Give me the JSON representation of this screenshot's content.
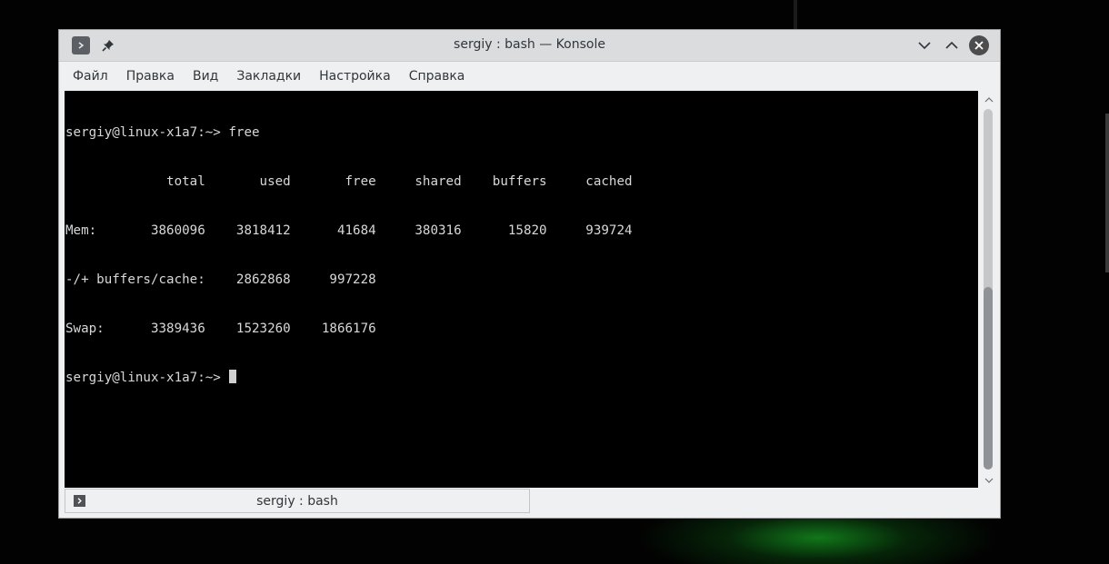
{
  "window": {
    "title": "sergiy : bash — Konsole"
  },
  "menu": {
    "items": [
      {
        "label": "Файл"
      },
      {
        "label": "Правка"
      },
      {
        "label": "Вид"
      },
      {
        "label": "Закладки"
      },
      {
        "label": "Настройка"
      },
      {
        "label": "Справка"
      }
    ]
  },
  "terminal": {
    "lines": [
      "sergiy@linux-x1a7:~> free",
      "             total       used       free     shared    buffers     cached",
      "Mem:       3860096    3818412      41684     380316      15820     939724",
      "-/+ buffers/cache:    2862868     997228",
      "Swap:      3389436    1523260    1866176"
    ],
    "prompt": "sergiy@linux-x1a7:~> "
  },
  "tabs": [
    {
      "label": "sergiy : bash"
    }
  ],
  "icons": {
    "app": "terminal-app-icon",
    "pin": "pin-icon",
    "minimize": "chevron-down-icon",
    "maximize": "chevron-up-icon",
    "close": "close-icon"
  },
  "colors": {
    "terminal_bg": "#000000",
    "terminal_fg": "#d8d8d8",
    "window_bg": "#eff0f1",
    "titlebar_bg": "#dadcde"
  }
}
